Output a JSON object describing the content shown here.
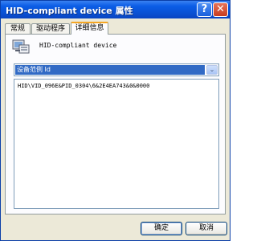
{
  "window": {
    "title": "HID-compliant device 属性",
    "help_glyph": "?",
    "close_glyph": "✕"
  },
  "tabs": [
    {
      "label": "常规"
    },
    {
      "label": "驱动程序"
    },
    {
      "label": "详细信息"
    }
  ],
  "device": {
    "name": "HID-compliant device",
    "icon": "hid-device-icon"
  },
  "property_select": {
    "selected": "设备范例 Id",
    "arrow": "⌄"
  },
  "values": [
    "HID\\VID_096E&PID_0304\\6&2E4EA743&0&0000"
  ],
  "buttons": {
    "ok": "确定",
    "cancel": "取消"
  },
  "colors": {
    "titlebar": "#0b5de6",
    "selection": "#316ac5",
    "window_bg": "#ece9d8",
    "close_button": "#c83c20"
  }
}
